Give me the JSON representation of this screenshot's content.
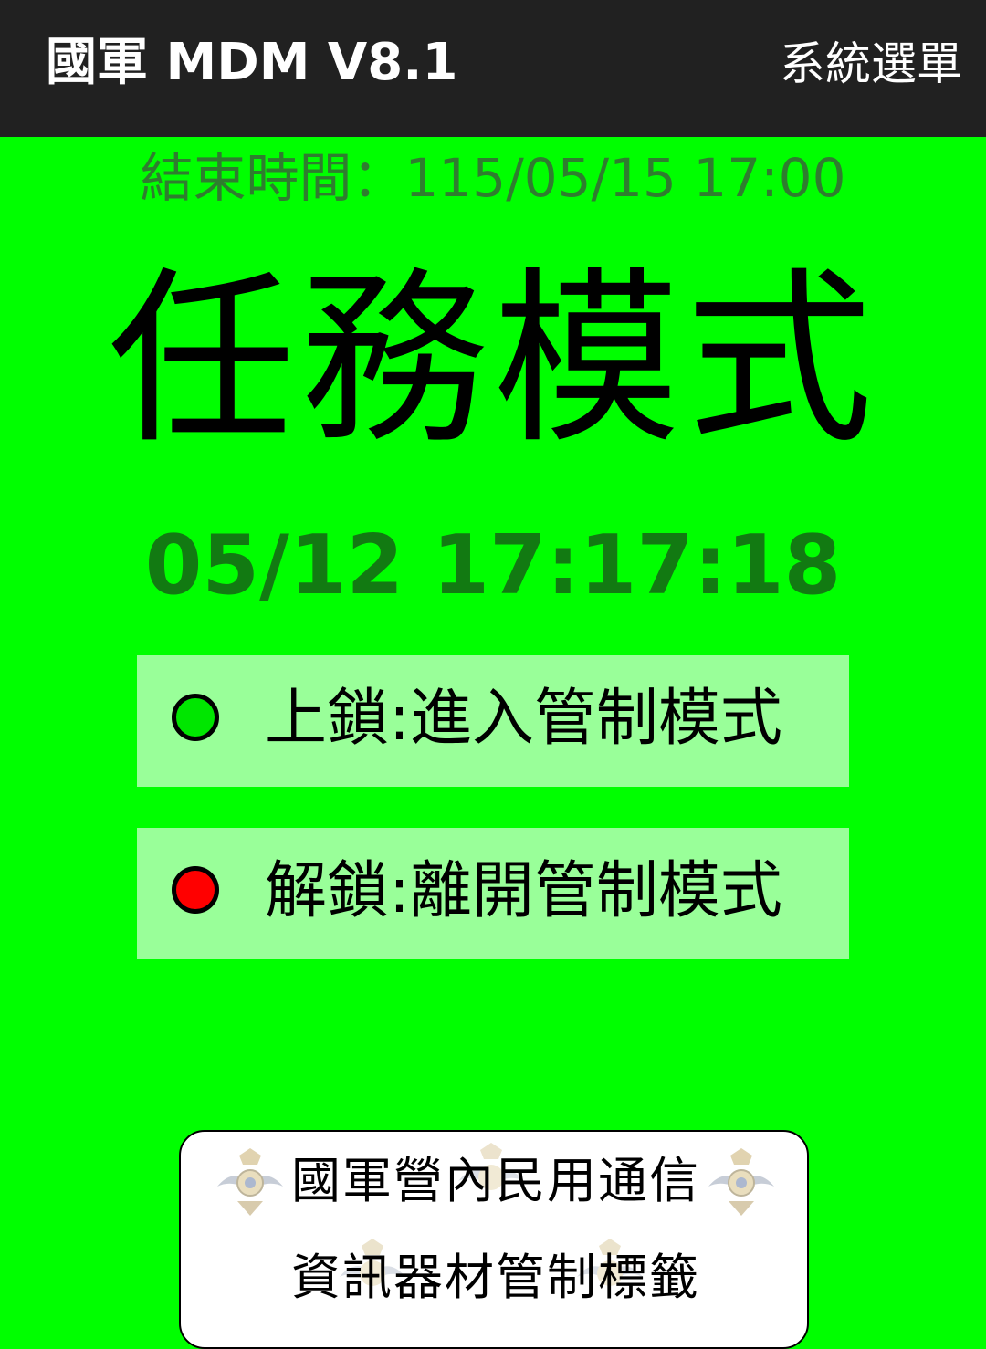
{
  "app_bar": {
    "title": "國軍 MDM V8.1",
    "menu_label": "系統選單"
  },
  "main": {
    "end_time": "結束時間：115/05/15 17:00",
    "mode_title": "任務模式",
    "clock": "05/12 17:17:18"
  },
  "options": {
    "lock_label": "上鎖:進入管制模式",
    "unlock_label": "解鎖:離開管制模式"
  },
  "tag": {
    "line1": "國軍營內民用通信",
    "line2": "資訊器材管制標籤"
  },
  "colors": {
    "background": "#00ff00",
    "app_bar": "#212121",
    "option_bg": "#99ff99",
    "lock_indicator": "#00e600",
    "unlock_indicator": "#ff0000",
    "clock_text": "#127a12",
    "end_time_text": "#2f7d2f"
  },
  "icons": {
    "lock_indicator": "green-circle-icon",
    "unlock_indicator": "red-circle-icon",
    "emblem": "military-emblem-icon"
  }
}
